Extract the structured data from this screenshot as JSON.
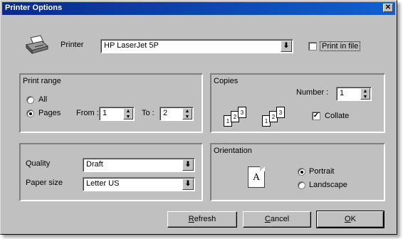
{
  "window": {
    "title": "Printer Options",
    "close_symbol": "✕"
  },
  "printer": {
    "label": "Printer",
    "value": "HP LaserJet 5P",
    "print_in_file_label": "Print in file",
    "print_in_file_checked": false,
    "icon": "printer-icon"
  },
  "print_range": {
    "title": "Print range",
    "all_label": "All",
    "pages_label": "Pages",
    "selected": "Pages",
    "from_label": "From :",
    "from_value": "1",
    "to_label": "To :",
    "to_value": "2"
  },
  "copies": {
    "title": "Copies",
    "number_label": "Number :",
    "number_value": "1",
    "collate_label": "Collate",
    "collate_checked": true,
    "stack_pages": [
      "1",
      "2",
      "3"
    ]
  },
  "quality": {
    "quality_label": "Quality",
    "quality_value": "Draft",
    "paper_label": "Paper size",
    "paper_value": "Letter US"
  },
  "orientation": {
    "title": "Orientation",
    "page_letter": "A",
    "portrait_label": "Portrait",
    "landscape_label": "Landscape",
    "selected": "Portrait"
  },
  "buttons": {
    "refresh": "Refresh",
    "refresh_mnemonic": "R",
    "refresh_rest": "efresh",
    "cancel_mnemonic": "C",
    "cancel_rest": "ancel",
    "ok_mnemonic": "O",
    "ok_rest": "K"
  },
  "glyphs": {
    "dropdown_arrow": "⬇",
    "spin_up": "▲",
    "spin_down": "▼",
    "check": "✓"
  }
}
